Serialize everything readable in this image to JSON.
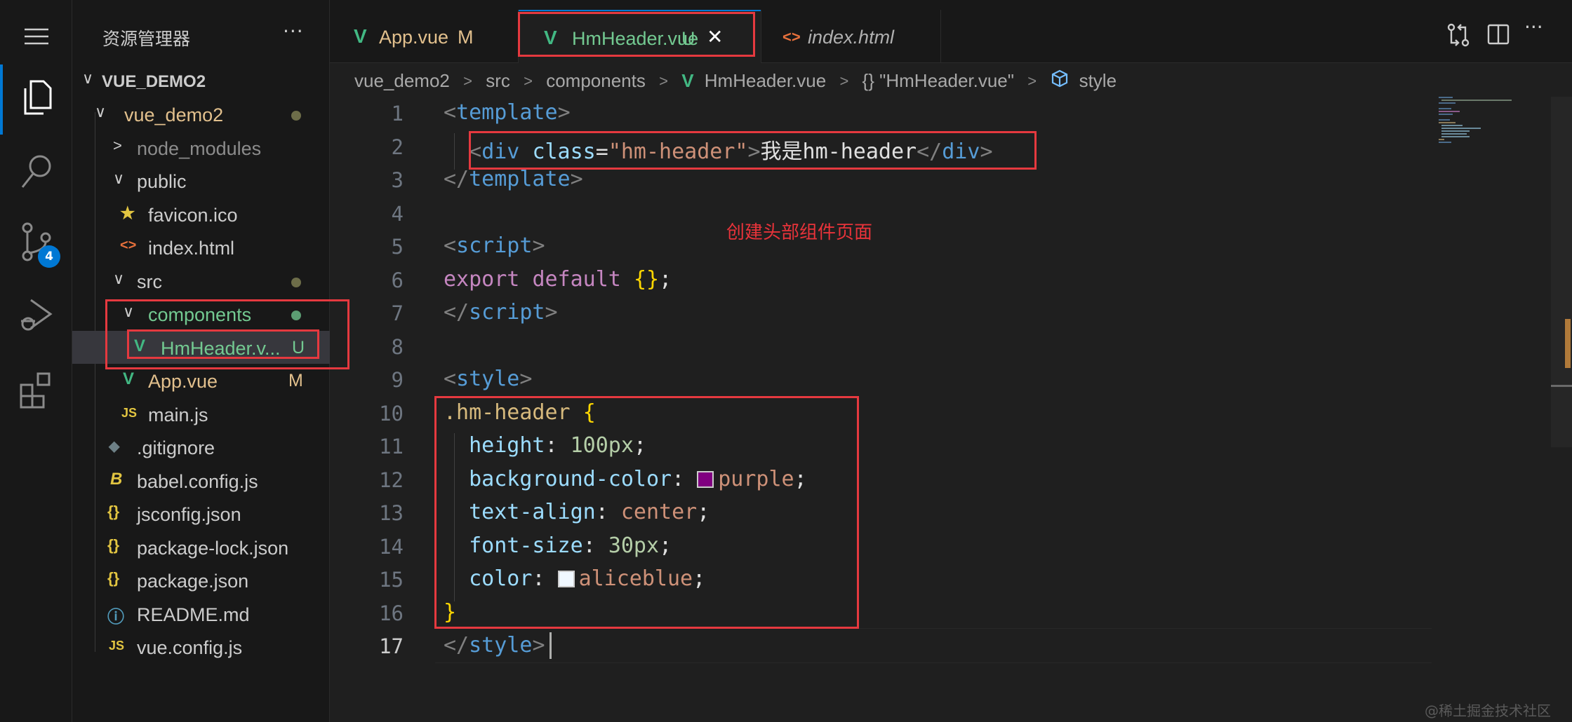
{
  "sidebar": {
    "title": "资源管理器",
    "more": "···",
    "tree": [
      {
        "label": "VUE_DEMO2",
        "chevron": "∨",
        "level": 0
      },
      {
        "label": "vue_demo2",
        "chevron": "∨",
        "level": 1
      },
      {
        "label": "node_modules",
        "chevron": ">",
        "level": 2
      },
      {
        "label": "public",
        "chevron": "∨",
        "level": 2
      },
      {
        "label": "favicon.ico",
        "icon": "★",
        "level": 3
      },
      {
        "label": "index.html",
        "icon": "<>",
        "level": 3
      },
      {
        "label": "src",
        "chevron": "∨",
        "level": 2
      },
      {
        "label": "components",
        "chevron": "∨",
        "level": 3
      },
      {
        "label": "HmHeader.v...",
        "icon": "V",
        "status": "U",
        "level": 4
      },
      {
        "label": "App.vue",
        "icon": "V",
        "status": "M",
        "level": 3
      },
      {
        "label": "main.js",
        "icon": "JS",
        "level": 3
      },
      {
        "label": ".gitignore",
        "icon": "◆",
        "level": 2
      },
      {
        "label": "babel.config.js",
        "icon": "B",
        "level": 2
      },
      {
        "label": "jsconfig.json",
        "icon": "{}",
        "level": 2
      },
      {
        "label": "package-lock.json",
        "icon": "{}",
        "level": 2
      },
      {
        "label": "package.json",
        "icon": "{}",
        "level": 2
      },
      {
        "label": "README.md",
        "icon": "ⓘ",
        "level": 2
      },
      {
        "label": "vue.config.js",
        "icon": "JS",
        "level": 2
      }
    ]
  },
  "activity": {
    "badge": "4"
  },
  "tabs": [
    {
      "label": "App.vue",
      "status": "M",
      "active": false,
      "italic": false
    },
    {
      "label": "HmHeader.vue",
      "status": "U",
      "active": true,
      "italic": false,
      "close": "✕"
    },
    {
      "label": "index.html",
      "status": "",
      "active": false,
      "italic": true
    }
  ],
  "breadcrumb": {
    "items": [
      "vue_demo2",
      "src",
      "components",
      "HmHeader.vue",
      "{} \"HmHeader.vue\"",
      "style"
    ]
  },
  "editor": {
    "line_numbers": [
      "1",
      "2",
      "3",
      "4",
      "5",
      "6",
      "7",
      "8",
      "9",
      "10",
      "11",
      "12",
      "13",
      "14",
      "15",
      "16",
      "17"
    ],
    "current_line": "17",
    "swatch_colors": {
      "purple": "#800080",
      "aliceblue": "#f0f8ff"
    }
  },
  "annotation": "创建头部组件页面",
  "watermark": "@稀土掘金技术社区",
  "colors": {
    "accent": "#0078d4",
    "highlight": "#e5393f",
    "vue_green": "#42b883",
    "untracked": "#73c991",
    "modified": "#e2c08d"
  }
}
